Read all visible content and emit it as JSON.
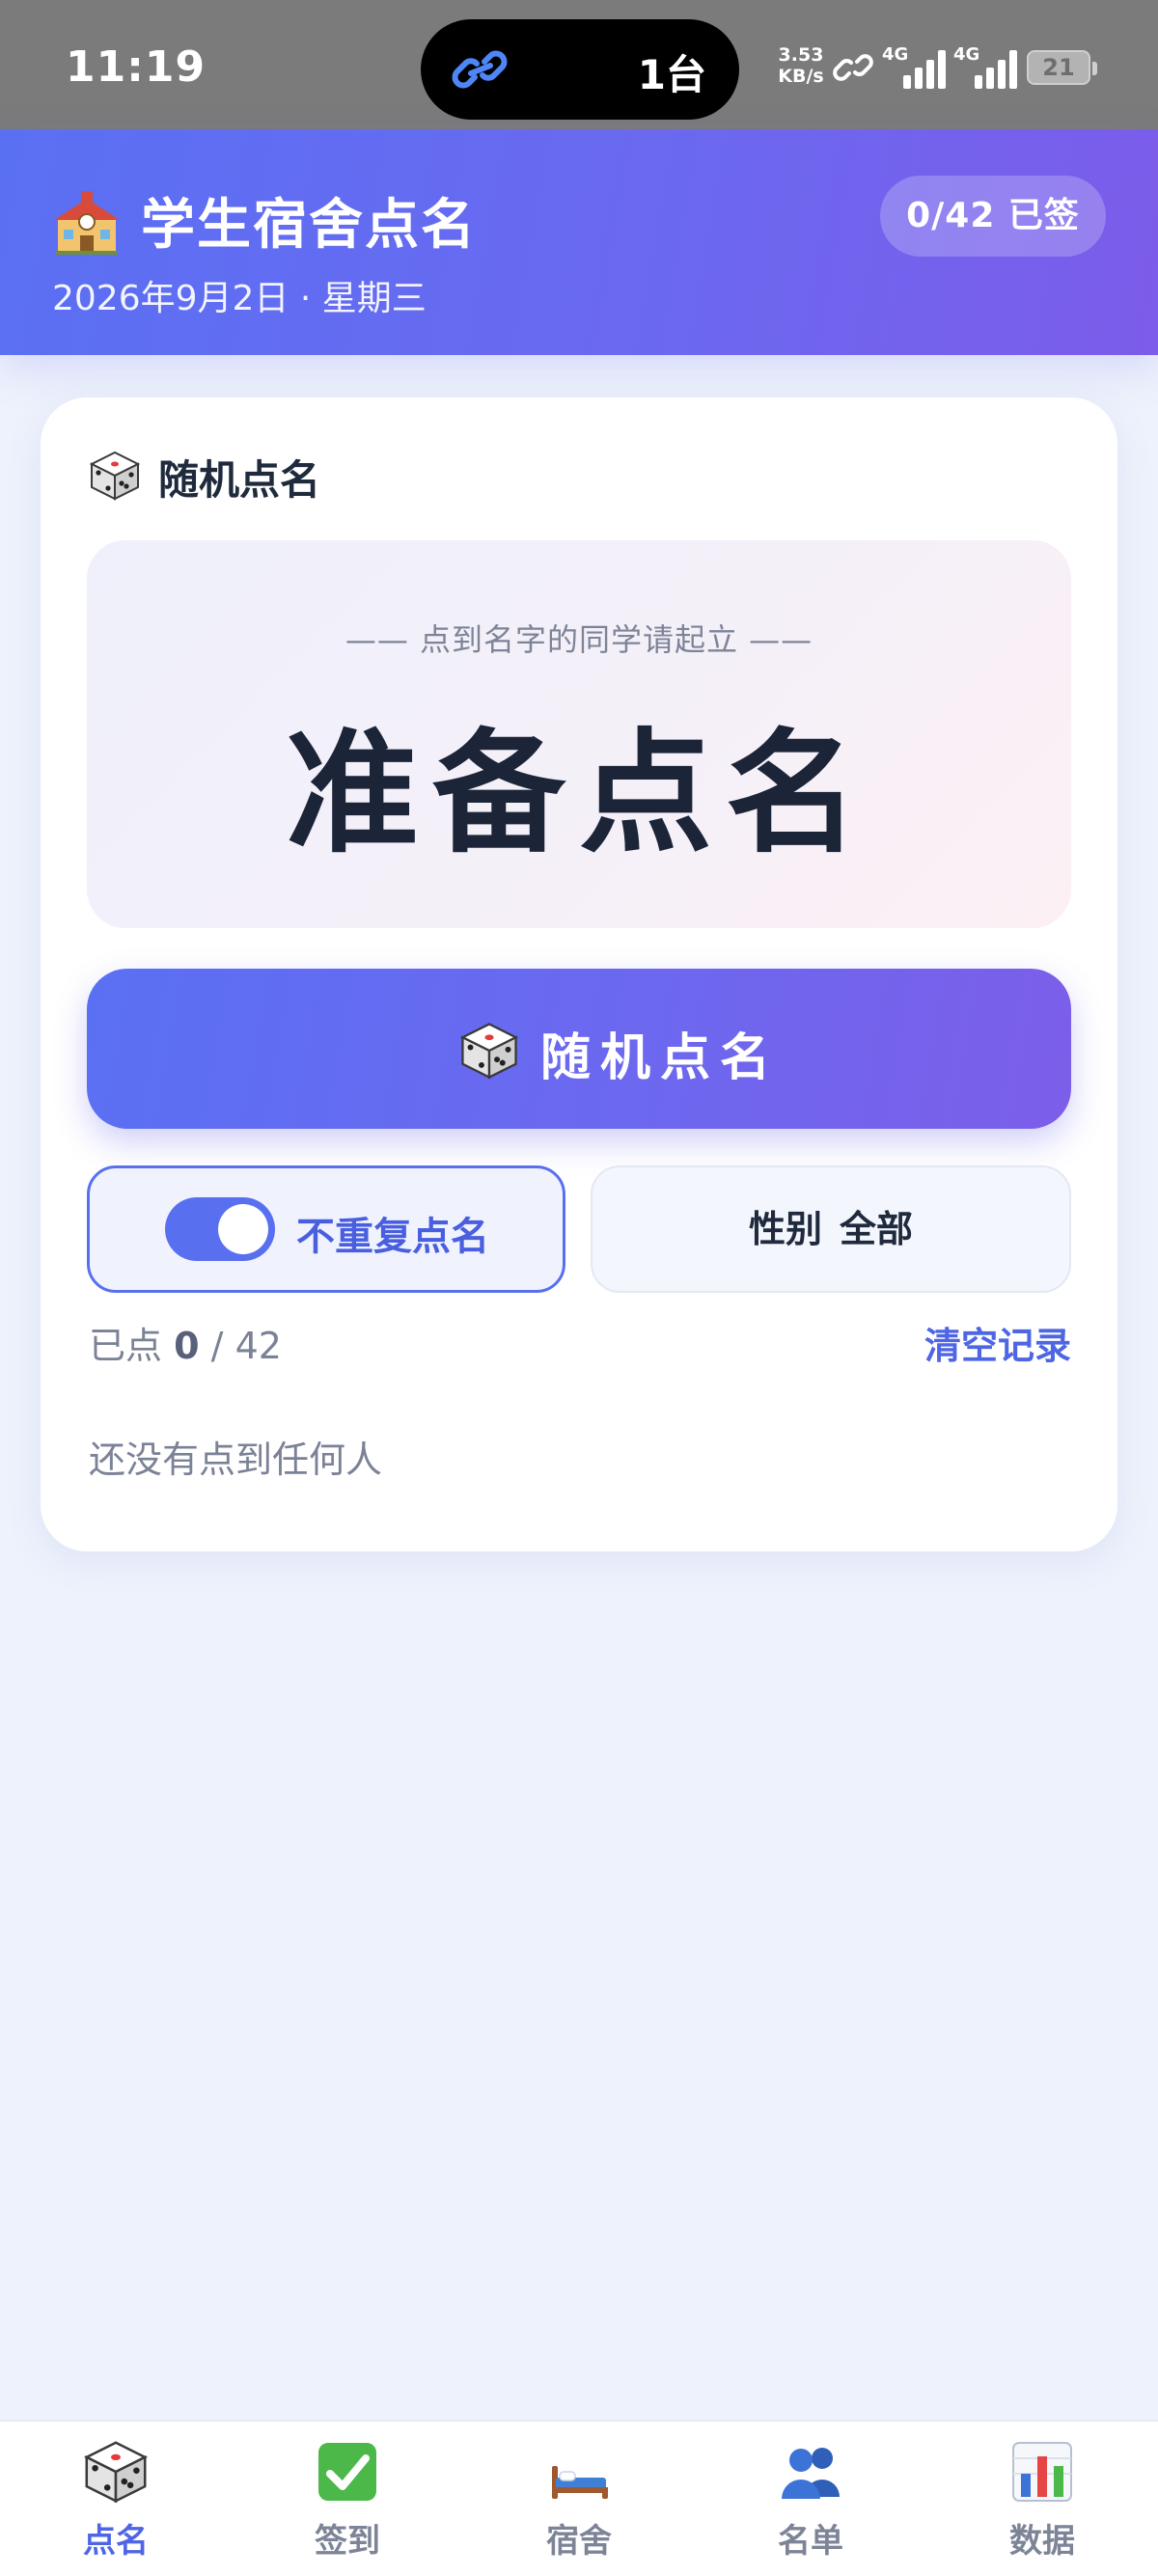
{
  "status_bar": {
    "time": "11:19",
    "island_text": "1台",
    "net_speed_value": "3.53",
    "net_speed_unit": "KB/s",
    "signal_1_label": "4G",
    "signal_2_label": "4G",
    "battery_level": "21"
  },
  "header": {
    "title": "学生宿舍点名",
    "date": "2026年9月2日 · 星期三",
    "signed_badge": "0/42 已签"
  },
  "roll_call": {
    "section_title": "随机点名",
    "hint": "—— 点到名字的同学请起立 ——",
    "current_name": "准备点名",
    "button_label": "随机点名",
    "no_repeat_label": "不重复点名",
    "no_repeat_enabled": true,
    "gender_label": "性别",
    "gender_value": "全部",
    "count_prefix": "已点",
    "called_count": "0",
    "count_separator": "/",
    "total_count": "42",
    "clear_label": "清空记录",
    "empty_message": "还没有点到任何人"
  },
  "nav": {
    "items": [
      {
        "label": "点名",
        "icon": "dice-icon",
        "active": true
      },
      {
        "label": "签到",
        "icon": "check-mark-icon",
        "active": false
      },
      {
        "label": "宿舍",
        "icon": "bed-icon",
        "active": false
      },
      {
        "label": "名单",
        "icon": "people-icon",
        "active": false
      },
      {
        "label": "数据",
        "icon": "bar-chart-icon",
        "active": false
      }
    ]
  },
  "colors": {
    "accent": "#5870f0",
    "accent_purple": "#7c5cea",
    "background": "#eef2fc",
    "status_bar": "#7b7b7b"
  }
}
